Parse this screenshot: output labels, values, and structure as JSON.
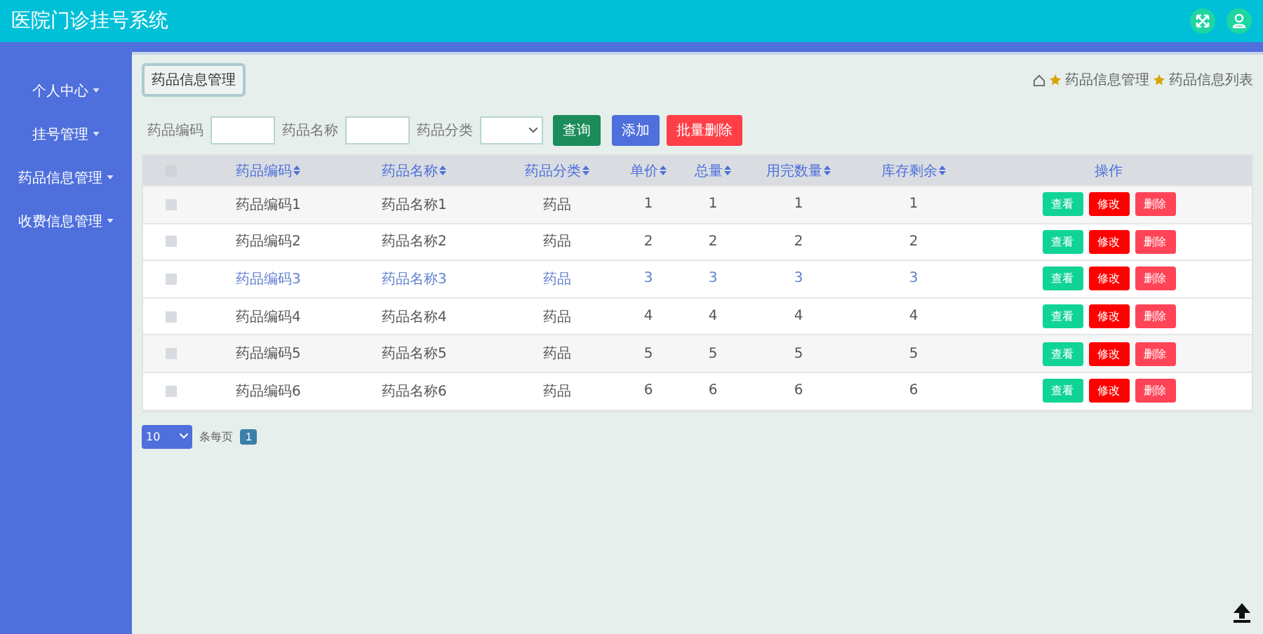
{
  "header": {
    "title": "医院门诊挂号系统"
  },
  "sidebar": {
    "items": [
      {
        "label": "个人中心"
      },
      {
        "label": "挂号管理"
      },
      {
        "label": "药品信息管理"
      },
      {
        "label": "收费信息管理"
      }
    ]
  },
  "page_title": "药品信息管理",
  "breadcrumb": [
    "药品信息管理",
    "药品信息列表"
  ],
  "search": {
    "fields": [
      {
        "label": "药品编码",
        "kind": "input"
      },
      {
        "label": "药品名称",
        "kind": "input"
      },
      {
        "label": "药品分类",
        "kind": "select"
      }
    ],
    "buttons": [
      {
        "label": "查询",
        "kind": "search"
      },
      {
        "label": "添加",
        "kind": "add"
      },
      {
        "label": "批量删除",
        "kind": "delete"
      }
    ]
  },
  "table": {
    "columns": [
      "药品编码",
      "药品名称",
      "药品分类",
      "单价",
      "总量",
      "用完数量",
      "库存剩余"
    ],
    "action_column": "操作",
    "select_all_checked": false,
    "rows": [
      {
        "cells": [
          "药品编码1",
          "药品名称1",
          "药品",
          "1",
          "1",
          "1",
          "1"
        ],
        "checked": false,
        "hovered": false,
        "actions": [
          "查看",
          "修改",
          "删除"
        ]
      },
      {
        "cells": [
          "药品编码2",
          "药品名称2",
          "药品",
          "2",
          "2",
          "2",
          "2"
        ],
        "checked": false,
        "hovered": false,
        "actions": [
          "查看",
          "修改",
          "删除"
        ]
      },
      {
        "cells": [
          "药品编码3",
          "药品名称3",
          "药品",
          "3",
          "3",
          "3",
          "3"
        ],
        "checked": false,
        "hovered": true,
        "actions": [
          "查看",
          "修改",
          "删除"
        ]
      },
      {
        "cells": [
          "药品编码4",
          "药品名称4",
          "药品",
          "4",
          "4",
          "4",
          "4"
        ],
        "checked": false,
        "hovered": false,
        "actions": [
          "查看",
          "修改",
          "删除"
        ]
      },
      {
        "cells": [
          "药品编码5",
          "药品名称5",
          "药品",
          "5",
          "5",
          "5",
          "5"
        ],
        "checked": false,
        "hovered": false,
        "actions": [
          "查看",
          "修改",
          "删除"
        ]
      },
      {
        "cells": [
          "药品编码6",
          "药品名称6",
          "药品",
          "6",
          "6",
          "6",
          "6"
        ],
        "checked": false,
        "hovered": false,
        "actions": [
          "查看",
          "修改",
          "删除"
        ]
      }
    ]
  },
  "pagination": {
    "page_size": "10",
    "per_page_label": "条每页",
    "pages": [
      {
        "label": "1",
        "selected": true
      }
    ]
  }
}
